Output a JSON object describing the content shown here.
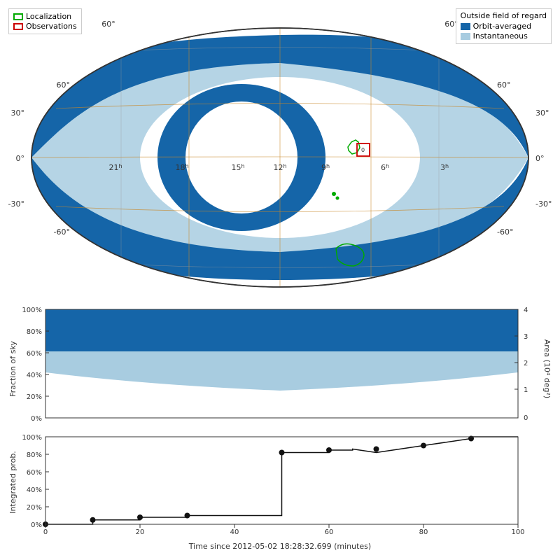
{
  "legend": {
    "left": {
      "items": [
        {
          "label": "Localization",
          "border_color": "#00aa00",
          "fill": "none"
        },
        {
          "label": "Observations",
          "border_color": "#cc0000",
          "fill": "none"
        }
      ]
    },
    "right": {
      "title": "Outside field of regard",
      "items": [
        {
          "label": "Orbit-averaged",
          "color": "#1565a8"
        },
        {
          "label": "Instantaneous",
          "color": "#a8cce0"
        }
      ]
    }
  },
  "skymap": {
    "axis_labels": {
      "longitude": [
        "21h",
        "18h",
        "15h",
        "12h",
        "9h",
        "6h",
        "3h"
      ],
      "latitude": [
        "60°",
        "30°",
        "0°",
        "-30°",
        "-60°"
      ],
      "right_lat": [
        "60°",
        "30°",
        "0°",
        "-30°",
        "-60°"
      ]
    }
  },
  "fraction_chart": {
    "title": "Fraction of sky",
    "right_axis": "Area (10⁴ deg²)",
    "y_ticks": [
      "100%",
      "80%",
      "60%",
      "40%",
      "20%",
      "0%"
    ],
    "y_ticks_right": [
      "4",
      "3",
      "2",
      "1",
      "0"
    ]
  },
  "integrated_chart": {
    "title_y": "Integrated prob.",
    "title_x": "Time since 2012-05-02 18:28:32.699 (minutes)",
    "y_ticks": [
      "100%",
      "80%",
      "60%",
      "40%",
      "20%",
      "0%"
    ],
    "x_ticks": [
      "0",
      "20",
      "40",
      "60",
      "80"
    ],
    "data_points": [
      {
        "x": 0,
        "y": 0
      },
      {
        "x": 10,
        "y": 5
      },
      {
        "x": 20,
        "y": 8
      },
      {
        "x": 30,
        "y": 10
      },
      {
        "x": 40,
        "y": 10
      },
      {
        "x": 50,
        "y": 72
      },
      {
        "x": 60,
        "y": 75
      },
      {
        "x": 65,
        "y": 80
      },
      {
        "x": 70,
        "y": 78
      },
      {
        "x": 80,
        "y": 82
      },
      {
        "x": 90,
        "y": 95
      },
      {
        "x": 95,
        "y": 96
      }
    ]
  }
}
